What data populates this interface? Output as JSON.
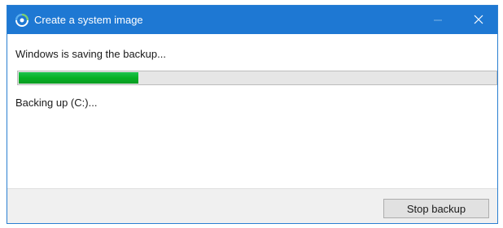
{
  "window": {
    "title": "Create a system image",
    "title_icon": "system-image-backup-icon",
    "minimize_icon": "minimize-icon",
    "close_icon": "close-icon"
  },
  "main": {
    "status": "Windows is saving the backup...",
    "progress_fraction": 0.25,
    "detail": "Backing up (C:)..."
  },
  "footer": {
    "stop_label": "Stop backup"
  },
  "colors": {
    "titlebar": "#1e78d3",
    "progress_fill": "#06b025",
    "progress_track": "#e6e6e6",
    "footer": "#f0f0f0"
  }
}
